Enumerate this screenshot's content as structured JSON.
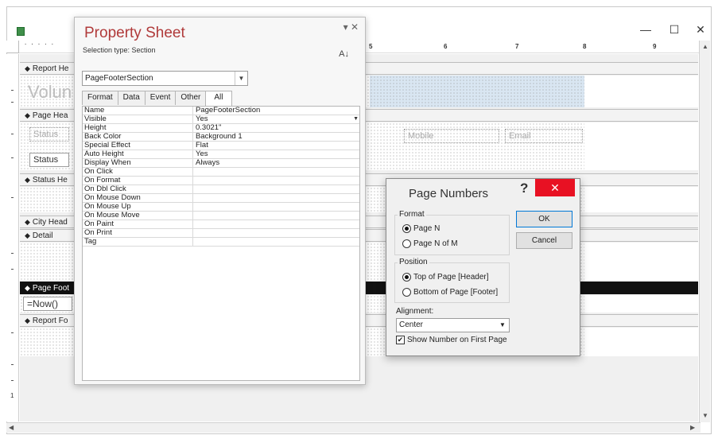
{
  "window": {
    "minimize": "—",
    "maximize": "☐",
    "close": "✕"
  },
  "ruler": {
    "numbers": [
      "5",
      "6",
      "7",
      "8",
      "9"
    ],
    "left_number": "1"
  },
  "report": {
    "bands": {
      "report_header": "Report He",
      "page_header": "Page Hea",
      "status_header": "Status He",
      "city_header": "City Head",
      "detail": "Detail",
      "page_footer": "Page Foot",
      "report_footer": "Report Fo"
    },
    "controls": {
      "title_ghost": "Volun",
      "status_label": "Status",
      "status_text": "Status",
      "mobile": "Mobile",
      "email": "Email",
      "now_expr": "=Now()"
    }
  },
  "property_sheet": {
    "title": "Property Sheet",
    "selection_type": "Selection type:  Section",
    "sort_icon": "A↓",
    "object": "PageFooterSection",
    "tabs": [
      "Format",
      "Data",
      "Event",
      "Other",
      "All"
    ],
    "active_tab": "All",
    "properties": [
      {
        "name": "Name",
        "value": "PageFooterSection"
      },
      {
        "name": "Visible",
        "value": "Yes"
      },
      {
        "name": "Height",
        "value": "0.3021\""
      },
      {
        "name": "Back Color",
        "value": "Background 1"
      },
      {
        "name": "Special Effect",
        "value": "Flat"
      },
      {
        "name": "Auto Height",
        "value": "Yes"
      },
      {
        "name": "Display When",
        "value": "Always"
      },
      {
        "name": "On Click",
        "value": ""
      },
      {
        "name": "On Format",
        "value": ""
      },
      {
        "name": "On Dbl Click",
        "value": ""
      },
      {
        "name": "On Mouse Down",
        "value": ""
      },
      {
        "name": "On Mouse Up",
        "value": ""
      },
      {
        "name": "On Mouse Move",
        "value": ""
      },
      {
        "name": "On Paint",
        "value": ""
      },
      {
        "name": "On Print",
        "value": ""
      },
      {
        "name": "Tag",
        "value": ""
      }
    ]
  },
  "page_numbers": {
    "title": "Page Numbers",
    "help": "?",
    "close": "✕",
    "format_label": "Format",
    "format_options": [
      "Page N",
      "Page N of M"
    ],
    "format_selected": "Page N",
    "position_label": "Position",
    "position_options": [
      "Top of Page [Header]",
      "Bottom of Page [Footer]"
    ],
    "position_selected": "Top of Page [Header]",
    "alignment_label": "Alignment:",
    "alignment_value": "Center",
    "show_first_page": "Show Number on First Page",
    "show_first_page_checked": true,
    "ok": "OK",
    "cancel": "Cancel"
  }
}
